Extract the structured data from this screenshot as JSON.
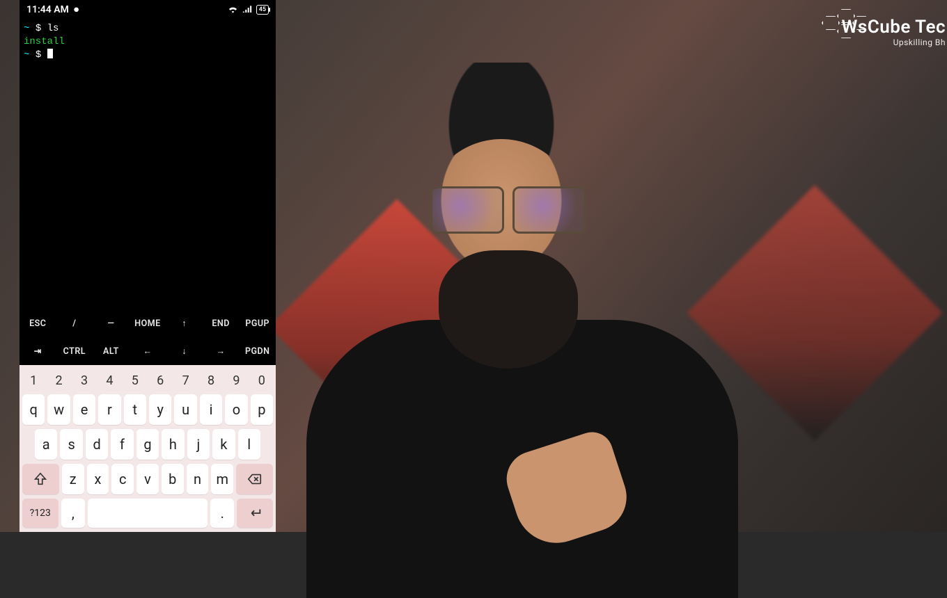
{
  "brand": {
    "name": "WsCube Tec",
    "tag": "Upskilling Bh"
  },
  "status": {
    "time": "11:44 AM",
    "battery": "45"
  },
  "terminal": {
    "line1_prompt": "~ $ ",
    "line1_cmd": "ls",
    "line2_output": "install",
    "line3_prompt": "~ $ "
  },
  "extra_keys": {
    "row1": [
      "ESC",
      "/",
      "—",
      "HOME",
      "↑",
      "END",
      "PGUP"
    ],
    "row2": [
      "⇥",
      "CTRL",
      "ALT",
      "←",
      "↓",
      "→",
      "PGDN"
    ]
  },
  "keyboard": {
    "numbers": [
      "1",
      "2",
      "3",
      "4",
      "5",
      "6",
      "7",
      "8",
      "9",
      "0"
    ],
    "row_q": [
      "q",
      "w",
      "e",
      "r",
      "t",
      "y",
      "u",
      "i",
      "o",
      "p"
    ],
    "row_a": [
      "a",
      "s",
      "d",
      "f",
      "g",
      "h",
      "j",
      "k",
      "l"
    ],
    "row_z": [
      "z",
      "x",
      "c",
      "v",
      "b",
      "n",
      "m"
    ],
    "symbols": {
      "mode": "?123",
      "comma": ",",
      "period": "."
    }
  }
}
